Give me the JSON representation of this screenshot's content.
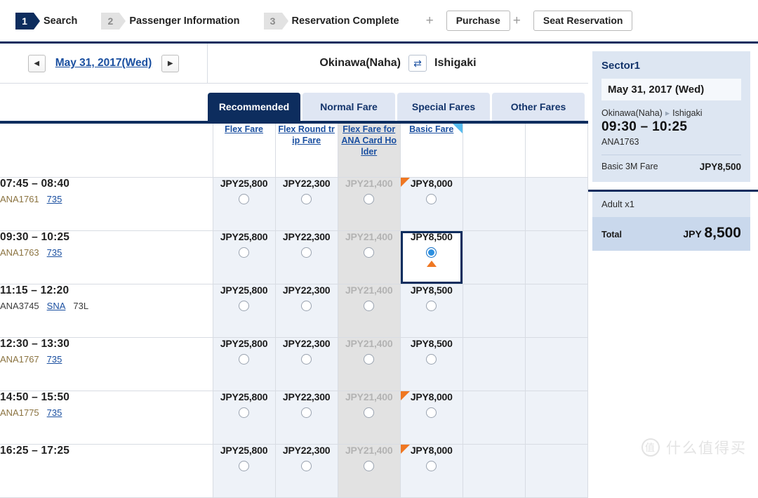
{
  "steps": [
    {
      "num": "1",
      "label": "Search",
      "state": "active"
    },
    {
      "num": "2",
      "label": "Passenger Information",
      "state": "idle"
    },
    {
      "num": "3",
      "label": "Reservation Complete",
      "state": "idle"
    }
  ],
  "step_extras": {
    "plus1": "+",
    "purchase": "Purchase",
    "plus2": "+",
    "seat_reservation": "Seat Reservation"
  },
  "datebar": {
    "prev_icon": "◀",
    "date": "May 31, 2017(Wed)",
    "next_icon": "▶",
    "origin": "Okinawa(Naha)",
    "swap_icon": "⇄",
    "destination": "Ishigaki"
  },
  "tabs": [
    {
      "label": "Recommended",
      "state": "active"
    },
    {
      "label": "Normal Fare",
      "state": "idle"
    },
    {
      "label": "Special Fares",
      "state": "idle"
    },
    {
      "label": "Other Fares",
      "state": "idle"
    }
  ],
  "fare_columns": [
    {
      "label": "Flex Fare",
      "disabled": false,
      "corner": ""
    },
    {
      "label": "Flex Round trip Fare",
      "disabled": false,
      "corner": ""
    },
    {
      "label": "Flex Fare for ANA Card Holder",
      "disabled": true,
      "corner": ""
    },
    {
      "label": "Basic Fare",
      "disabled": false,
      "corner": "blue"
    },
    {
      "label": "",
      "disabled": false,
      "corner": ""
    },
    {
      "label": "",
      "disabled": false,
      "corner": ""
    }
  ],
  "flights": [
    {
      "time": "07:45 – 08:40",
      "flight_no": "ANA1761",
      "flight_no_style": "gold",
      "link": "735",
      "plain": "",
      "prices": [
        {
          "value": "JPY25,800",
          "muted": false,
          "corner": "",
          "selected": false
        },
        {
          "value": "JPY22,300",
          "muted": false,
          "corner": "",
          "selected": false
        },
        {
          "value": "JPY21,400",
          "muted": true,
          "corner": "",
          "selected": false
        },
        {
          "value": "JPY8,000",
          "muted": false,
          "corner": "orange",
          "selected": false
        }
      ]
    },
    {
      "time": "09:30 – 10:25",
      "flight_no": "ANA1763",
      "flight_no_style": "gold",
      "link": "735",
      "plain": "",
      "prices": [
        {
          "value": "JPY25,800",
          "muted": false,
          "corner": "",
          "selected": false
        },
        {
          "value": "JPY22,300",
          "muted": false,
          "corner": "",
          "selected": false
        },
        {
          "value": "JPY21,400",
          "muted": true,
          "corner": "",
          "selected": false
        },
        {
          "value": "JPY8,500",
          "muted": false,
          "corner": "",
          "selected": true
        }
      ]
    },
    {
      "time": "11:15 – 12:20",
      "flight_no": "ANA3745",
      "flight_no_style": "gray",
      "link": "SNA",
      "plain": "73L",
      "prices": [
        {
          "value": "JPY25,800",
          "muted": false,
          "corner": "",
          "selected": false
        },
        {
          "value": "JPY22,300",
          "muted": false,
          "corner": "",
          "selected": false
        },
        {
          "value": "JPY21,400",
          "muted": true,
          "corner": "",
          "selected": false
        },
        {
          "value": "JPY8,500",
          "muted": false,
          "corner": "",
          "selected": false
        }
      ]
    },
    {
      "time": "12:30 – 13:30",
      "flight_no": "ANA1767",
      "flight_no_style": "gold",
      "link": "735",
      "plain": "",
      "prices": [
        {
          "value": "JPY25,800",
          "muted": false,
          "corner": "",
          "selected": false
        },
        {
          "value": "JPY22,300",
          "muted": false,
          "corner": "",
          "selected": false
        },
        {
          "value": "JPY21,400",
          "muted": true,
          "corner": "",
          "selected": false
        },
        {
          "value": "JPY8,500",
          "muted": false,
          "corner": "",
          "selected": false
        }
      ]
    },
    {
      "time": "14:50 – 15:50",
      "flight_no": "ANA1775",
      "flight_no_style": "gold",
      "link": "735",
      "plain": "",
      "prices": [
        {
          "value": "JPY25,800",
          "muted": false,
          "corner": "",
          "selected": false
        },
        {
          "value": "JPY22,300",
          "muted": false,
          "corner": "",
          "selected": false
        },
        {
          "value": "JPY21,400",
          "muted": true,
          "corner": "",
          "selected": false
        },
        {
          "value": "JPY8,000",
          "muted": false,
          "corner": "orange",
          "selected": false
        }
      ]
    },
    {
      "time": "16:25 – 17:25",
      "flight_no": "",
      "flight_no_style": "gold",
      "link": "",
      "plain": "",
      "prices": [
        {
          "value": "JPY25,800",
          "muted": false,
          "corner": "",
          "selected": false
        },
        {
          "value": "JPY22,300",
          "muted": false,
          "corner": "",
          "selected": false
        },
        {
          "value": "JPY21,400",
          "muted": true,
          "corner": "",
          "selected": false
        },
        {
          "value": "JPY8,000",
          "muted": false,
          "corner": "orange",
          "selected": false
        }
      ]
    }
  ],
  "sidebar": {
    "sector": "Sector1",
    "date": "May 31, 2017 (Wed)",
    "origin": "Okinawa(Naha)",
    "arrow": "▸",
    "destination": "Ishigaki",
    "time": "09:30 – 10:25",
    "flight_no": "ANA1763",
    "fare_name": "Basic 3M Fare",
    "fare_amount": "JPY8,500",
    "passengers": "Adult x1",
    "total_label": "Total",
    "total_currency": "JPY",
    "total_amount": "8,500"
  },
  "watermark": {
    "mark": "值",
    "text": "什么值得买"
  },
  "colors": {
    "navy": "#0d2d5e",
    "link_blue": "#1a4fa0",
    "accent_orange": "#ef7722",
    "badge_blue": "#57bbee",
    "row_bg": "#eef2f8",
    "disabled_bg": "#e2e2e2"
  }
}
